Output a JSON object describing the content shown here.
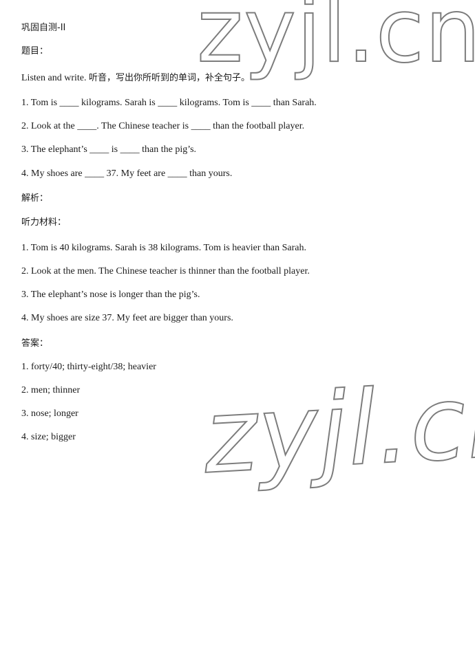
{
  "document": {
    "title": "巩固自测-II",
    "background_color": "#ffffff",
    "text_color": "#1a1a1a"
  },
  "watermark": {
    "text": "zyjl.cn",
    "color": "#7c7c7c",
    "style": "outline",
    "instances": [
      {
        "label": "top-right-watermark",
        "text": "zyjl.cn"
      },
      {
        "label": "bottom-watermark",
        "text": "zyjl.cn"
      }
    ]
  },
  "sections": {
    "questions_heading": "题目：",
    "analysis_heading": "解析：",
    "listening_heading": "听力材料：",
    "answers_heading": "答案："
  },
  "instruction": {
    "english": "Listen and write.",
    "chinese": "听音，写出你所听到的单词，补全句子。"
  },
  "questions": [
    "1. Tom is ____ kilograms. Sarah is ____ kilograms. Tom is ____ than Sarah.",
    "2. Look at the ____. The Chinese teacher is ____ than the football player.",
    "3. The elephant’s ____ is ____ than the pig’s.",
    "4. My shoes are ____ 37. My feet are ____ than yours."
  ],
  "listening_material": [
    "1. Tom is 40 kilograms. Sarah is 38 kilograms. Tom is heavier than Sarah.",
    "2. Look at the men. The Chinese teacher is thinner than the football player.",
    "3. The elephant’s nose is longer than the pig’s.",
    "4. My shoes are size 37. My feet are bigger than yours."
  ],
  "answers": [
    "1. forty/40; thirty-eight/38; heavier",
    "2. men; thinner",
    "3. nose; longer",
    "4. size; bigger"
  ]
}
